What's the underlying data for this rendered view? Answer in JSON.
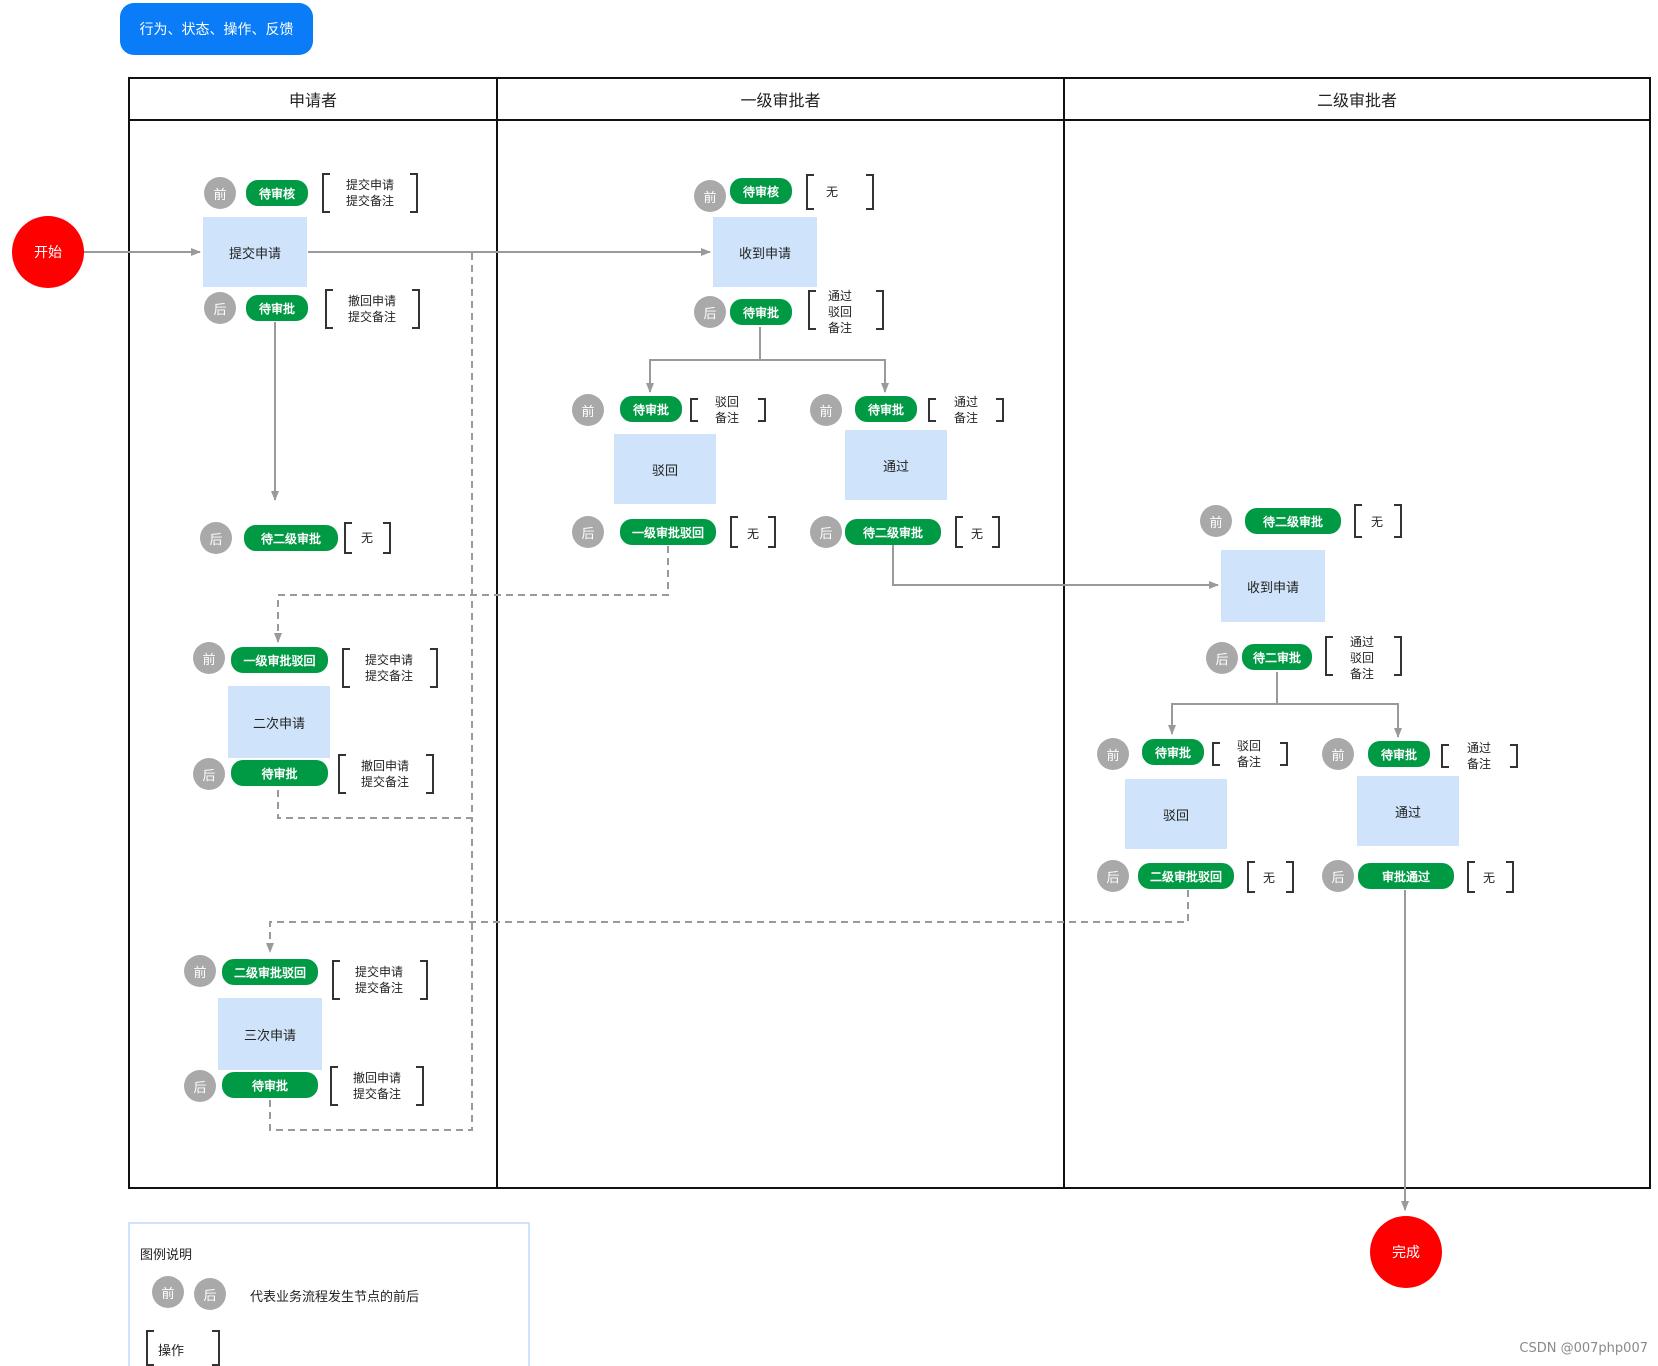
{
  "tag": "行为、状态、操作、反馈",
  "lanes": [
    "申请者",
    "一级审批者",
    "二级审批者"
  ],
  "start": "开始",
  "end": "完成",
  "before": "前",
  "after": "后",
  "ap": {
    "s1": {
      "pre": "待审核",
      "pre_ops": [
        "提交申请",
        "提交备注"
      ],
      "node": "提交申请",
      "post": "待审批",
      "post_ops": [
        "撤回申请",
        "提交备注"
      ]
    },
    "s1_result": {
      "post": "待二级审批",
      "post_ops": [
        "无"
      ]
    },
    "s2": {
      "pre": "一级审批驳回",
      "pre_ops": [
        "提交申请",
        "提交备注"
      ],
      "node": "二次申请",
      "post": "待审批",
      "post_ops": [
        "撤回申请",
        "提交备注"
      ]
    },
    "s3": {
      "pre": "二级审批驳回",
      "pre_ops": [
        "提交申请",
        "提交备注"
      ],
      "node": "三次申请",
      "post": "待审批",
      "post_ops": [
        "撤回申请",
        "提交备注"
      ]
    }
  },
  "l1": {
    "recv": {
      "pre": "待审核",
      "pre_ops": [
        "无"
      ],
      "node": "收到申请",
      "post": "待审批",
      "post_ops": [
        "通过",
        "驳回",
        "备注"
      ]
    },
    "reject": {
      "pre": "待审批",
      "pre_ops": [
        "驳回",
        "备注"
      ],
      "node": "驳回",
      "post": "一级审批驳回",
      "post_ops": [
        "无"
      ]
    },
    "pass": {
      "pre": "待审批",
      "pre_ops": [
        "通过",
        "备注"
      ],
      "node": "通过",
      "post": "待二级审批",
      "post_ops": [
        "无"
      ]
    }
  },
  "l2": {
    "recv": {
      "pre": "待二级审批",
      "pre_ops": [
        "无"
      ],
      "node": "收到申请",
      "post": "待二审批",
      "post_ops": [
        "通过",
        "驳回",
        "备注"
      ]
    },
    "reject": {
      "pre": "待审批",
      "pre_ops": [
        "驳回",
        "备注"
      ],
      "node": "驳回",
      "post": "二级审批驳回",
      "post_ops": [
        "无"
      ]
    },
    "pass": {
      "pre": "待审批",
      "pre_ops": [
        "通过",
        "备注"
      ],
      "node": "通过",
      "post": "审批通过",
      "post_ops": [
        "无"
      ]
    }
  },
  "legend": {
    "title": "图例说明",
    "badge_desc": "代表业务流程发生节点的前后",
    "ops_label": "操作"
  },
  "watermark": "CSDN @007php007",
  "colors": {
    "pill": "#009a44",
    "node": "#cfe4fa",
    "badge": "#a9a9a9",
    "terminal": "#fe0000",
    "tag": "#0a7cf7"
  }
}
